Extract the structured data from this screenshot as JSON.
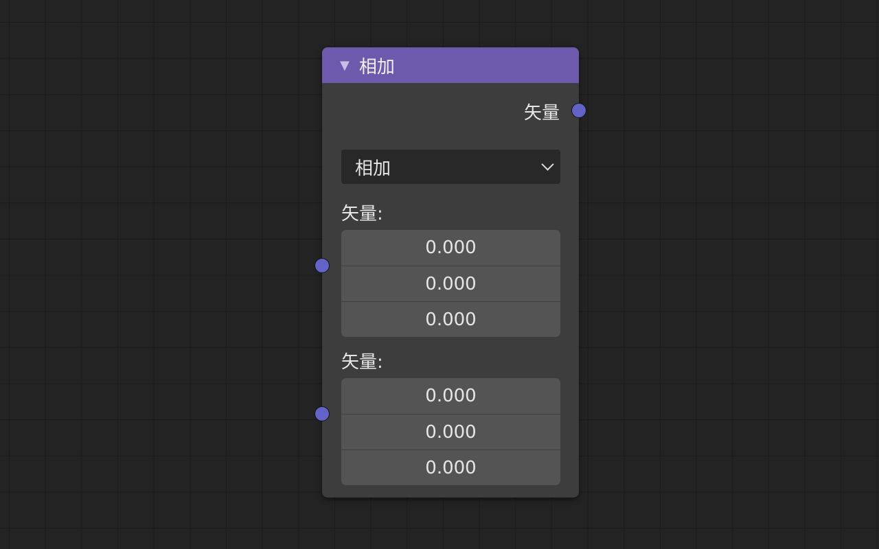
{
  "node": {
    "title": "相加",
    "output_label": "矢量",
    "operation": "相加",
    "inputs": [
      {
        "label": "矢量:",
        "values": [
          "0.000",
          "0.000",
          "0.000"
        ]
      },
      {
        "label": "矢量:",
        "values": [
          "0.000",
          "0.000",
          "0.000"
        ]
      }
    ]
  },
  "colors": {
    "header": "#6c5aad",
    "socket": "#6363c7"
  }
}
